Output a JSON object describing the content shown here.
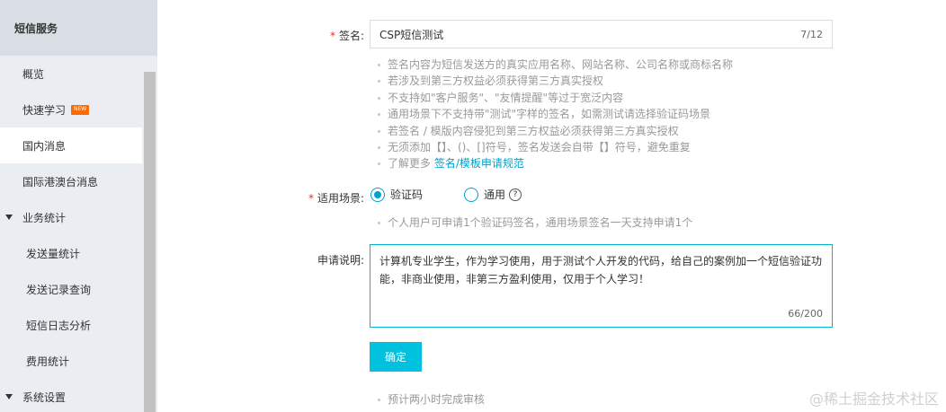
{
  "sidebar": {
    "header": "短信服务",
    "items": [
      {
        "label": "概览"
      },
      {
        "label": "快速学习",
        "badge": "NEW"
      },
      {
        "label": "国内消息"
      },
      {
        "label": "国际港澳台消息"
      },
      {
        "label": "业务统计"
      },
      {
        "label": "发送量统计"
      },
      {
        "label": "发送记录查询"
      },
      {
        "label": "短信日志分析"
      },
      {
        "label": "费用统计"
      },
      {
        "label": "系统设置"
      }
    ]
  },
  "form": {
    "signature": {
      "required_mark": "*",
      "label": "签名:",
      "value": "CSP短信测试",
      "counter": "7/12"
    },
    "tips": [
      "签名内容为短信发送方的真实应用名称、网站名称、公司名称或商标名称",
      "若涉及到第三方权益必须获得第三方真实授权",
      "不支持如\"客户服务\"、\"友情提醒\"等过于宽泛内容",
      "通用场景下不支持带\"测试\"字样的签名，如需测试请选择验证码场景",
      "若签名 / 模版内容侵犯到第三方权益必须获得第三方真实授权",
      "无须添加【】、()、[]符号，签名发送会自带【】符号，避免重复"
    ],
    "learn_more": {
      "prefix": "了解更多",
      "link": "签名/模板申请规范"
    },
    "scene": {
      "required_mark": "*",
      "label": "适用场景:",
      "options": [
        "验证码",
        "通用"
      ],
      "selected": "验证码",
      "help": "?",
      "tip": "个人用户可申请1个验证码签名，通用场景签名一天支持申请1个"
    },
    "description": {
      "label": "申请说明:",
      "value": "计算机专业学生，作为学习使用，用于测试个人开发的代码，给自己的案例加一个短信验证功能，非商业使用，非第三方盈利使用，仅用于个人学习！",
      "counter": "66/200"
    },
    "submit_label": "确定",
    "footer_tip": "预计两小时完成审核"
  },
  "watermark": "@稀土掘金技术社区",
  "colors": {
    "accent": "#00c1de",
    "link": "#00a2ca",
    "required": "#e0301e",
    "badge": "#ff6a00"
  }
}
